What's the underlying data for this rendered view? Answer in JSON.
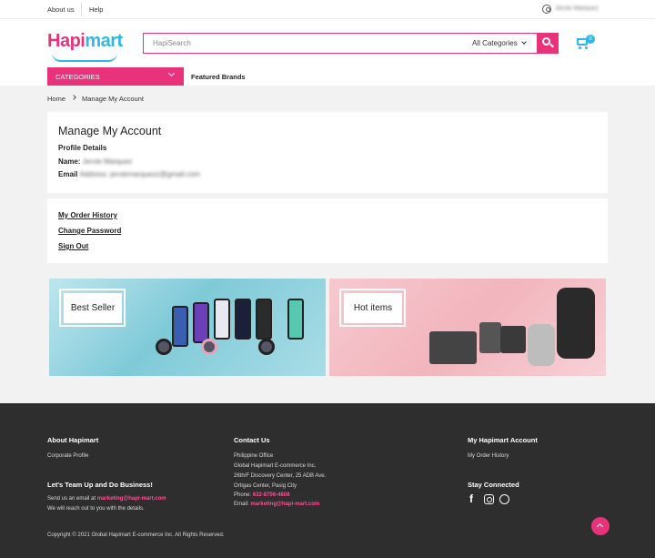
{
  "topbar": {
    "about": "About us",
    "help": "Help",
    "user": "Jervie Marquez"
  },
  "header": {
    "logo_a": "Hapi",
    "logo_b": "mart",
    "search_placeholder": "HapiSearch",
    "search_category": "All Categories",
    "cart_count": "0",
    "categories_label": "CATEGORIES",
    "featured_label": "Featured Brands"
  },
  "breadcrumb": {
    "home": "Home",
    "current": "Manage My Account"
  },
  "account": {
    "title": "Manage My Account",
    "profile_heading": "Profile Details",
    "name_label": "Name:",
    "name_value": "Jervie Marquez",
    "email_label": "Email",
    "email_value": "Address: jerviemarquezz@gmail.com"
  },
  "links": {
    "order_history": "My Order History",
    "change_password": "Change Password",
    "sign_out": "Sign Out"
  },
  "banners": {
    "left": "Best Seller",
    "right": "Hot items"
  },
  "footer": {
    "about_title": "About Hapimart",
    "corporate_profile": "Corporate Profile",
    "team_title": "Let's Team Up and Do Business!",
    "send_text": "Send us an email at",
    "send_email": "marketing@hapi-mart.com",
    "reach_text": "We will reach out to you with the details.",
    "contact_title": "Contact Us",
    "office": "Philippine Office",
    "company": "Global Hapimart E-commerce Inc.",
    "address1": "26th/F Discovery Center, 25 ADB Ave.",
    "address2": "Ortigas Center, Pasig City",
    "phone_label": "Phone:",
    "phone": "632-8706-4808",
    "email_label": "Email:",
    "email": "marketing@hapi-mart.com",
    "account_title": "My Hapimart Account",
    "account_order_history": "My Order History",
    "stay_title": "Stay Connected",
    "copyright": "Copyright © 2021 Global Hapimart E-commerce Inc. All Rights Reserved."
  },
  "colors": {
    "brand_pink": "#e8337a",
    "brand_blue": "#2fb7e6",
    "footer_bg": "#2e2e2e"
  },
  "icons": [
    "user-icon",
    "search-icon",
    "cart-icon",
    "chevron-down-icon",
    "chevron-right-icon",
    "facebook-icon",
    "instagram-icon",
    "viber-icon",
    "scroll-top-icon"
  ]
}
